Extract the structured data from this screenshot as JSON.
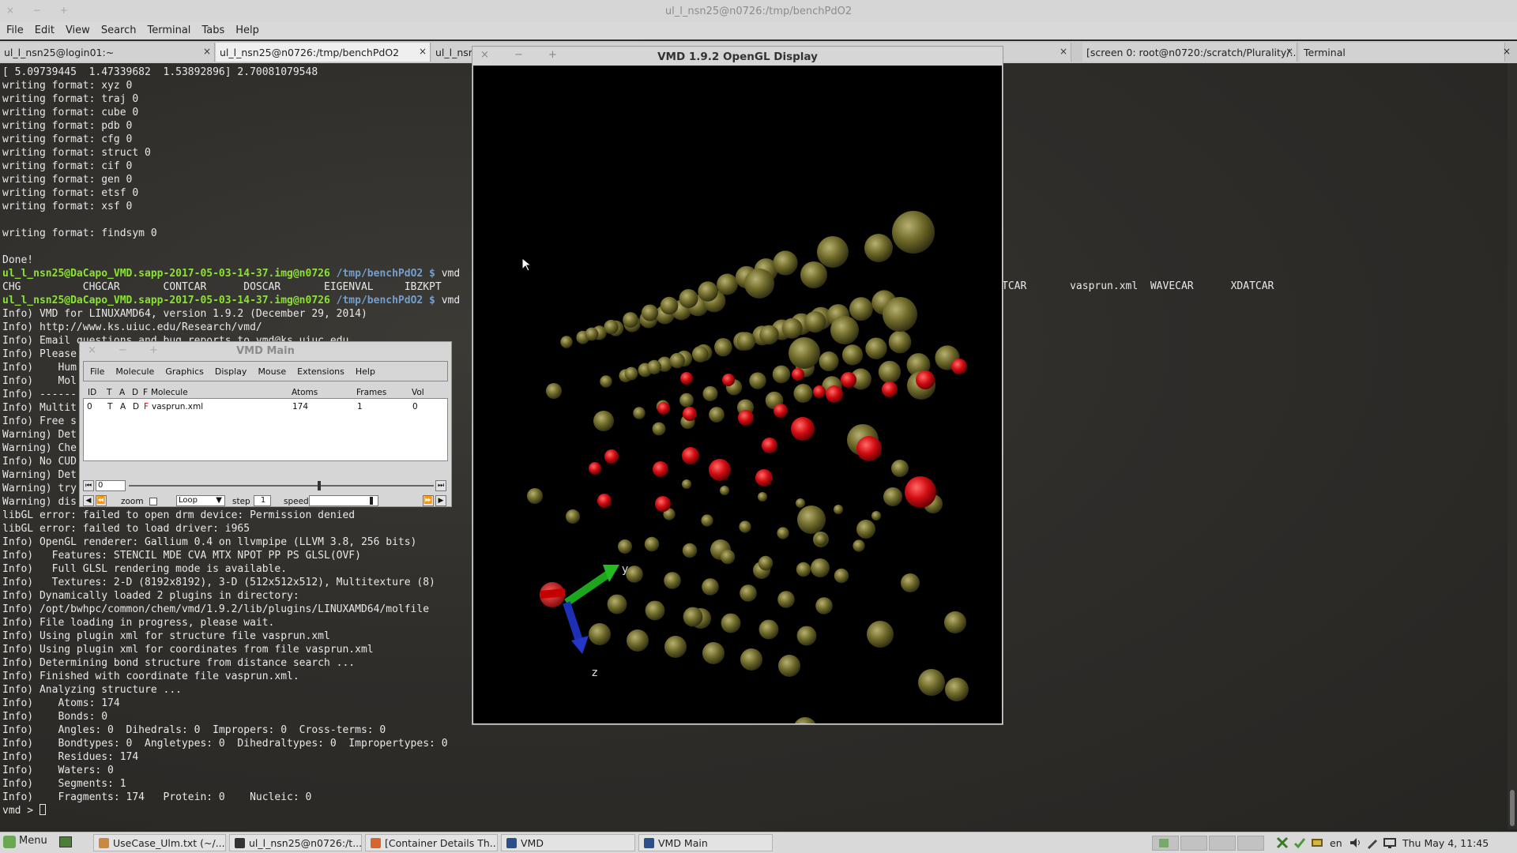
{
  "terminal": {
    "window_title": "ul_l_nsn25@n0726:/tmp/benchPdO2",
    "window_buttons": "× − +",
    "menu": [
      "File",
      "Edit",
      "View",
      "Search",
      "Terminal",
      "Tabs",
      "Help"
    ],
    "tabs": [
      {
        "label": "ul_l_nsn25@login01:~"
      },
      {
        "label": "ul_l_nsn25@n0726:/tmp/benchPdO2"
      },
      {
        "label": "ul_l_nsn"
      },
      {
        "label": "[screen 0: root@n0720:/scratch/Plurality/..."
      },
      {
        "label": "Terminal"
      }
    ],
    "close_glyph": "×",
    "lines": [
      {
        "parts": [
          {
            "t": "[ 5.09739445  1.47339682  1.53892896] 2.70081079548"
          }
        ]
      },
      {
        "parts": [
          {
            "t": "writing format: xyz 0"
          }
        ]
      },
      {
        "parts": [
          {
            "t": "writing format: traj 0"
          }
        ]
      },
      {
        "parts": [
          {
            "t": "writing format: cube 0"
          }
        ]
      },
      {
        "parts": [
          {
            "t": "writing format: pdb 0"
          }
        ]
      },
      {
        "parts": [
          {
            "t": "writing format: cfg 0"
          }
        ]
      },
      {
        "parts": [
          {
            "t": "writing format: struct 0"
          }
        ]
      },
      {
        "parts": [
          {
            "t": "writing format: cif 0"
          }
        ]
      },
      {
        "parts": [
          {
            "t": "writing format: gen 0"
          }
        ]
      },
      {
        "parts": [
          {
            "t": "writing format: etsf 0"
          }
        ]
      },
      {
        "parts": [
          {
            "t": "writing format: xsf 0"
          }
        ]
      },
      {
        "parts": [
          {
            "t": ""
          }
        ]
      },
      {
        "parts": [
          {
            "t": "writing format: findsym 0"
          }
        ]
      },
      {
        "parts": [
          {
            "t": ""
          }
        ]
      },
      {
        "parts": [
          {
            "t": "Done!"
          }
        ]
      },
      {
        "parts": [
          {
            "t": "ul_l_nsn25@DaCapo_VMD.sapp-2017-05-03-14-37.img@n0726",
            "c": "g"
          },
          {
            "t": " "
          },
          {
            "t": "/tmp/benchPdO2 $",
            "c": "b"
          },
          {
            "t": " vmd"
          }
        ]
      },
      {
        "parts": [
          {
            "t": "CHG          CHGCAR       CONTCAR      DOSCAR       EIGENVAL     IBZKPT"
          }
        ]
      },
      {
        "parts": [
          {
            "t": "ul_l_nsn25@DaCapo_VMD.sapp-2017-05-03-14-37.img@n0726",
            "c": "g"
          },
          {
            "t": " "
          },
          {
            "t": "/tmp/benchPdO2 $",
            "c": "b"
          },
          {
            "t": " vmd"
          }
        ]
      },
      {
        "parts": [
          {
            "t": "Info) VMD for LINUXAMD64, version 1.9.2 (December 29, 2014)"
          }
        ]
      },
      {
        "parts": [
          {
            "t": "Info) http://www.ks.uiuc.edu/Research/vmd/"
          }
        ]
      },
      {
        "parts": [
          {
            "t": "Info) Email questions and bug reports to vmd@ks.uiuc.edu"
          }
        ]
      },
      {
        "parts": [
          {
            "t": "Info) Please"
          }
        ]
      },
      {
        "parts": [
          {
            "t": "Info)    Hum"
          }
        ]
      },
      {
        "parts": [
          {
            "t": "Info)    Mol"
          }
        ]
      },
      {
        "parts": [
          {
            "t": "Info) ------"
          }
        ]
      },
      {
        "parts": [
          {
            "t": "Info) Multit"
          }
        ]
      },
      {
        "parts": [
          {
            "t": "Info) Free s"
          }
        ]
      },
      {
        "parts": [
          {
            "t": "Warning) Det"
          }
        ]
      },
      {
        "parts": [
          {
            "t": "Warning) Che"
          }
        ]
      },
      {
        "parts": [
          {
            "t": "Info) No CUD"
          }
        ]
      },
      {
        "parts": [
          {
            "t": "Warning) Det"
          }
        ]
      },
      {
        "parts": [
          {
            "t": "Warning) try"
          }
        ]
      },
      {
        "parts": [
          {
            "t": "Warning) dis"
          }
        ]
      },
      {
        "parts": [
          {
            "t": "libGL error: failed to open drm device: Permission denied"
          }
        ]
      },
      {
        "parts": [
          {
            "t": "libGL error: failed to load driver: i965"
          }
        ]
      },
      {
        "parts": [
          {
            "t": "Info) OpenGL renderer: Gallium 0.4 on llvmpipe (LLVM 3.8, 256 bits)"
          }
        ]
      },
      {
        "parts": [
          {
            "t": "Info)   Features: STENCIL MDE CVA MTX NPOT PP PS GLSL(OVF)"
          }
        ]
      },
      {
        "parts": [
          {
            "t": "Info)   Full GLSL rendering mode is available."
          }
        ]
      },
      {
        "parts": [
          {
            "t": "Info)   Textures: 2-D (8192x8192), 3-D (512x512x512), Multitexture (8)"
          }
        ]
      },
      {
        "parts": [
          {
            "t": "Info) Dynamically loaded 2 plugins in directory:"
          }
        ]
      },
      {
        "parts": [
          {
            "t": "Info) /opt/bwhpc/common/chem/vmd/1.9.2/lib/plugins/LINUXAMD64/molfile"
          }
        ]
      },
      {
        "parts": [
          {
            "t": "Info) File loading in progress, please wait."
          }
        ]
      },
      {
        "parts": [
          {
            "t": "Info) Using plugin xml for structure file vasprun.xml"
          }
        ]
      },
      {
        "parts": [
          {
            "t": "Info) Using plugin xml for coordinates from file vasprun.xml"
          }
        ]
      },
      {
        "parts": [
          {
            "t": "Info) Determining bond structure from distance search ..."
          }
        ]
      },
      {
        "parts": [
          {
            "t": "Info) Finished with coordinate file vasprun.xml."
          }
        ]
      },
      {
        "parts": [
          {
            "t": "Info) Analyzing structure ..."
          }
        ]
      },
      {
        "parts": [
          {
            "t": "Info)    Atoms: 174"
          }
        ]
      },
      {
        "parts": [
          {
            "t": "Info)    Bonds: 0"
          }
        ]
      },
      {
        "parts": [
          {
            "t": "Info)    Angles: 0  Dihedrals: 0  Impropers: 0  Cross-terms: 0"
          }
        ]
      },
      {
        "parts": [
          {
            "t": "Info)    Bondtypes: 0  Angletypes: 0  Dihedraltypes: 0  Impropertypes: 0"
          }
        ]
      },
      {
        "parts": [
          {
            "t": "Info)    Residues: 174"
          }
        ]
      },
      {
        "parts": [
          {
            "t": "Info)    Waters: 0"
          }
        ]
      },
      {
        "parts": [
          {
            "t": "Info)    Segments: 1"
          }
        ]
      },
      {
        "parts": [
          {
            "t": "Info)    Fragments: 174   Protein: 0    Nucleic: 0"
          }
        ]
      }
    ],
    "prompt": "vmd > ",
    "right_overflow_text": "TCAR       vasprun.xml  WAVECAR      XDATCAR"
  },
  "gl_display": {
    "title": "VMD 1.9.2 OpenGL Display",
    "window_buttons": "× − +",
    "axes": {
      "y_label": "y",
      "z_label": "z"
    },
    "colors": {
      "background": "#000000",
      "pd_atom": "#6f6a2a",
      "o_atom": "#d20d12"
    }
  },
  "vmd_main": {
    "title": "VMD Main",
    "window_buttons": "× − +",
    "menu": [
      "File",
      "Molecule",
      "Graphics",
      "Display",
      "Mouse",
      "Extensions",
      "Help"
    ],
    "columns": [
      "ID",
      "T",
      "A",
      "D",
      "F",
      "Molecule",
      "Atoms",
      "Frames",
      "Vol"
    ],
    "molecule": {
      "id": "0",
      "t": "T",
      "a": "A",
      "d": "D",
      "f": "F",
      "name": "vasprun.xml",
      "atoms": "174",
      "frames": "1",
      "vol": "0"
    },
    "frame_value": "0",
    "frame_position": 0.62,
    "zoom_label": "zoom",
    "loop_option": "Loop",
    "step_label": "step",
    "step_value": "1",
    "speed_label": "speed",
    "speed_level": 0.9
  },
  "taskbar": {
    "menu_label": "Menu",
    "items": [
      {
        "label": "UseCase_Ulm.txt (~/..."
      },
      {
        "label": "ul_l_nsn25@n0726:/t..."
      },
      {
        "label": "[Container Details Th..."
      },
      {
        "label": "VMD"
      },
      {
        "label": "VMD Main"
      }
    ],
    "language": "en",
    "clock": "Thu May 4, 11:45"
  }
}
